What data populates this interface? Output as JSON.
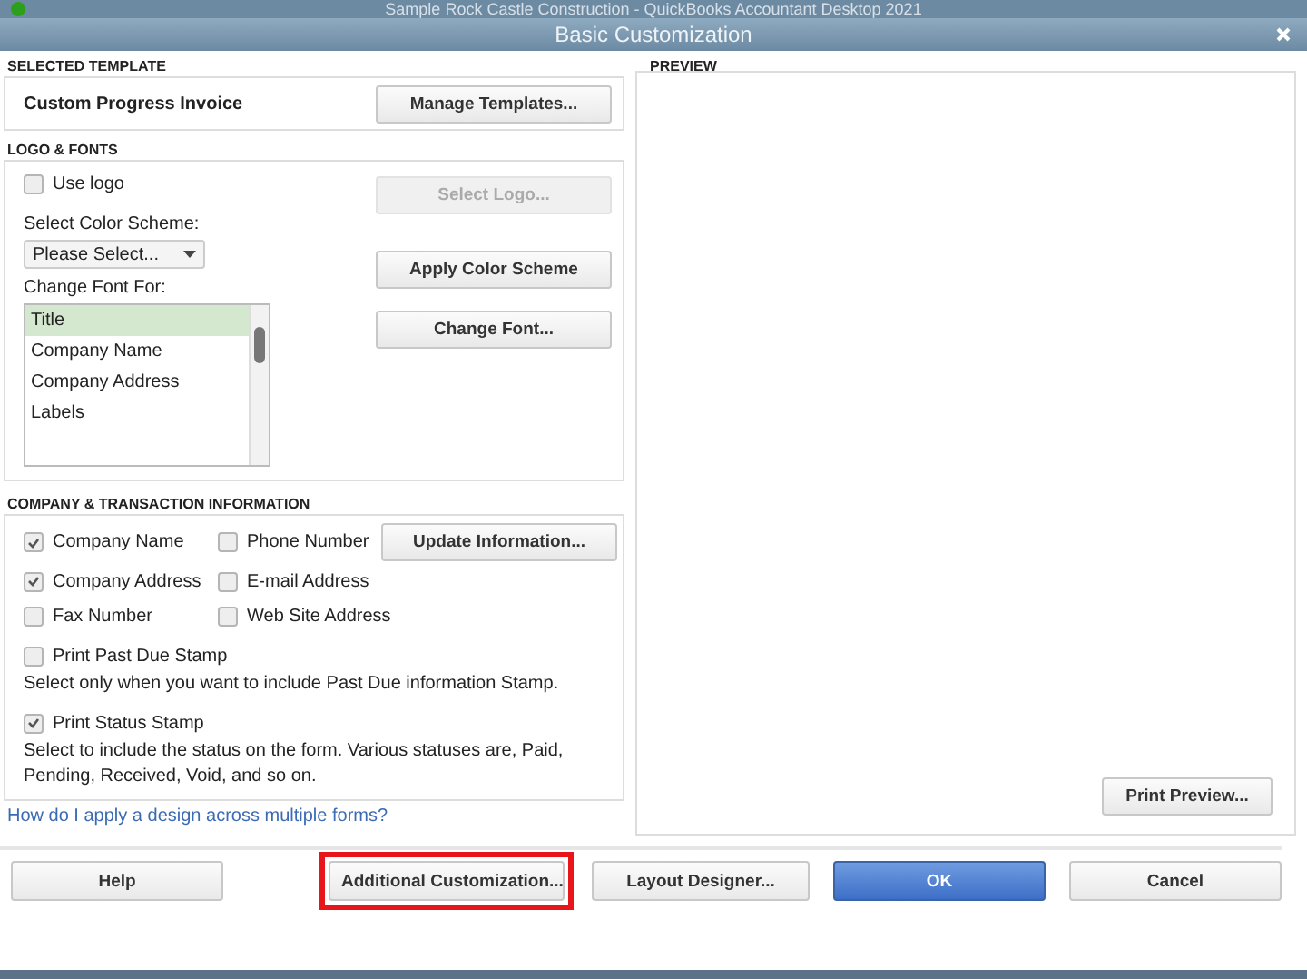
{
  "app_title": "Sample Rock Castle Construction  - QuickBooks Accountant Desktop 2021",
  "window": {
    "title": "Basic Customization"
  },
  "selected_template": {
    "heading": "SELECTED TEMPLATE",
    "name": "Custom Progress Invoice",
    "button": "Manage Templates..."
  },
  "logo_fonts": {
    "heading": "LOGO & FONTS",
    "use_logo": {
      "label": "Use logo",
      "checked": false
    },
    "select_logo": {
      "label": "Select Logo...",
      "disabled": true
    },
    "color_scheme_label": "Select Color Scheme:",
    "color_scheme": {
      "value": "Please Select..."
    },
    "apply_button": "Apply Color Scheme",
    "font_label": "Change Font For:",
    "font_items": [
      {
        "label": "Title",
        "selected": true
      },
      {
        "label": "Company Name",
        "selected": false
      },
      {
        "label": "Company Address",
        "selected": false
      },
      {
        "label": "Labels",
        "selected": false
      }
    ],
    "change_font_button": "Change Font..."
  },
  "company_info": {
    "heading": "COMPANY & TRANSACTION INFORMATION",
    "options": [
      {
        "label": "Company Name",
        "checked": true
      },
      {
        "label": "Phone Number",
        "checked": false
      },
      {
        "label": "Company Address",
        "checked": true
      },
      {
        "label": "E-mail Address",
        "checked": false
      },
      {
        "label": "Fax Number",
        "checked": false
      },
      {
        "label": "Web Site Address",
        "checked": false
      }
    ],
    "update_button": "Update Information...",
    "stamps": [
      {
        "label": "Print Past Due Stamp",
        "checked": false,
        "note": "Select only when you want to include Past Due information Stamp."
      },
      {
        "label": "Print Status Stamp",
        "checked": true,
        "note": "Select to include the status on the form. Various statuses are, Paid, Pending, Received, Void, and so on."
      }
    ]
  },
  "help_link": "How do I apply a design across multiple forms?",
  "preview": {
    "heading": "PREVIEW",
    "button": "Print Preview..."
  },
  "buttons": [
    {
      "label": "Help",
      "kind": "plain",
      "highlighted": false
    },
    {
      "label": "Additional Customization...",
      "kind": "plain",
      "highlighted": true
    },
    {
      "label": "Layout Designer...",
      "kind": "plain",
      "highlighted": false
    },
    {
      "label": "OK",
      "kind": "primary",
      "highlighted": false
    },
    {
      "label": "Cancel",
      "kind": "plain",
      "highlighted": false
    }
  ]
}
